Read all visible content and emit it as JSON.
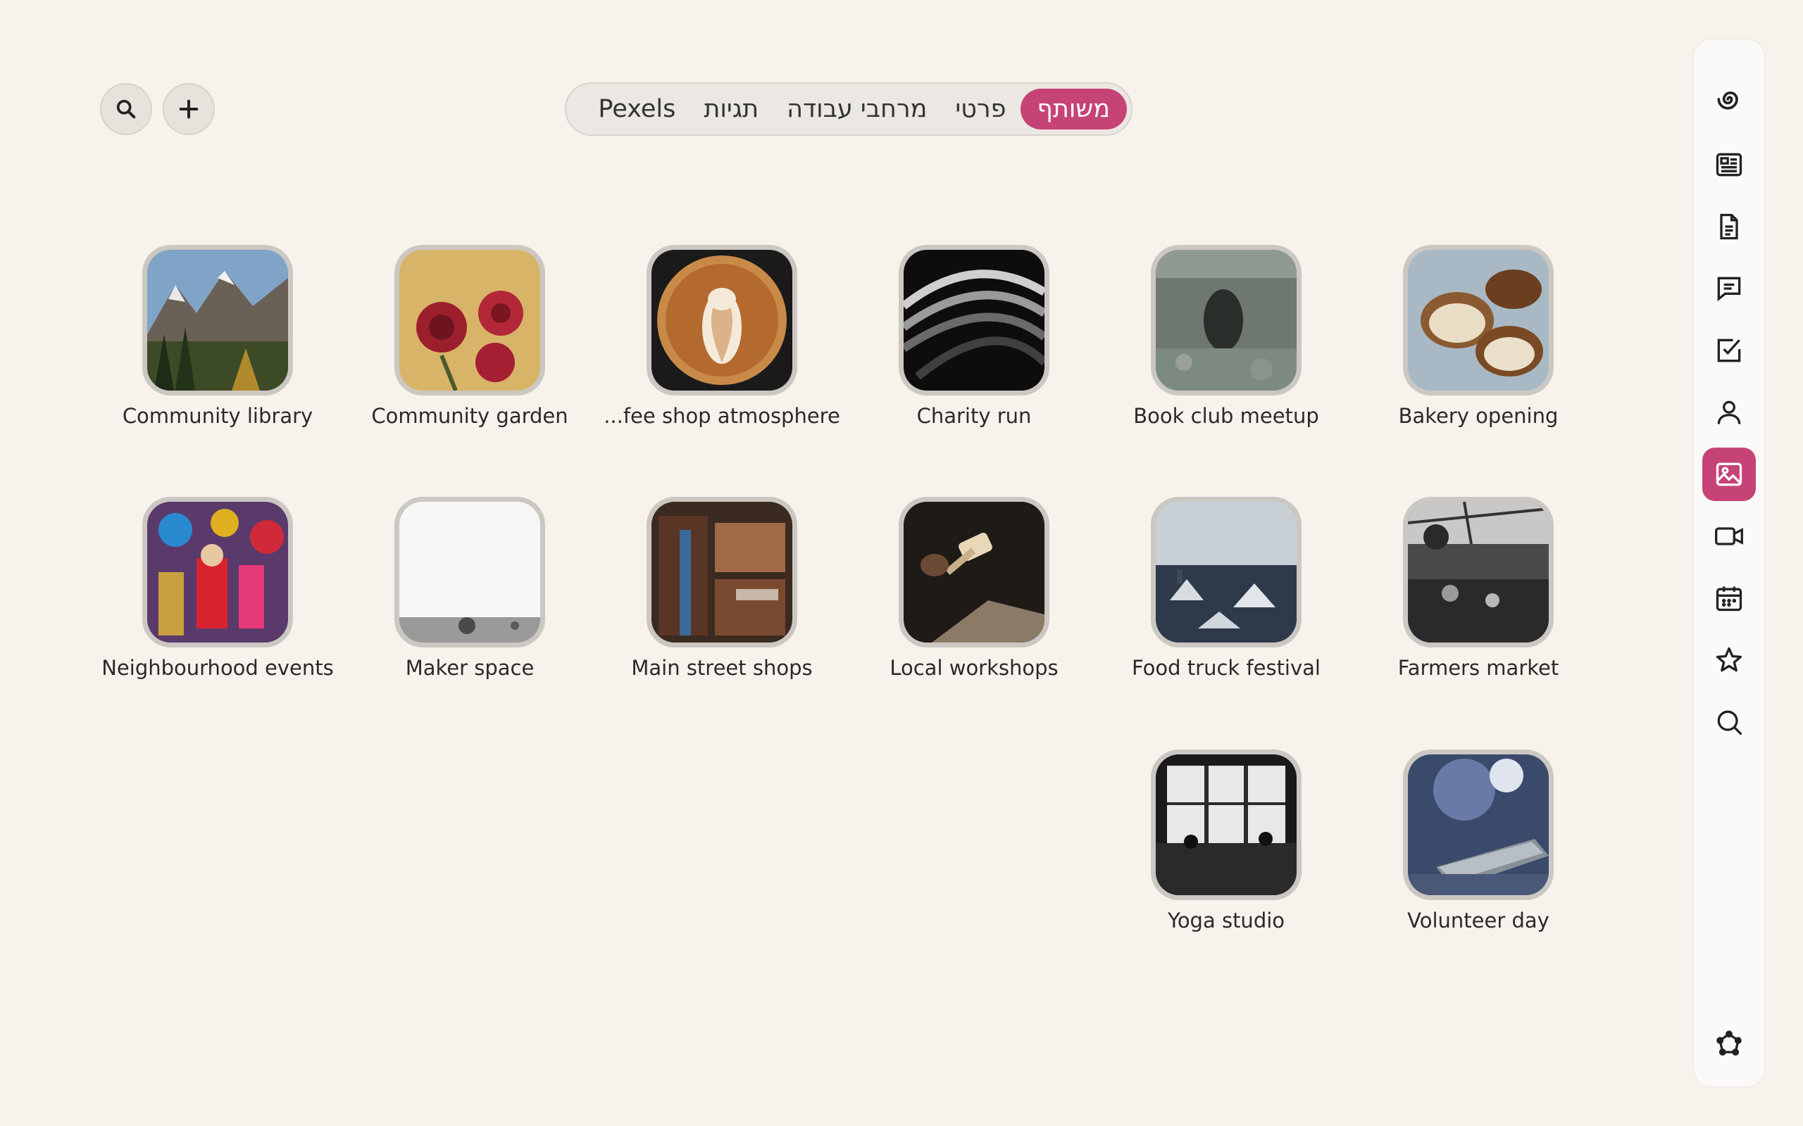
{
  "toolbar": {
    "search_icon": "search-icon",
    "add_icon": "plus-icon"
  },
  "tabs": [
    {
      "label": "משותף",
      "active": true
    },
    {
      "label": "פרטי",
      "active": false
    },
    {
      "label": "מרחבי עבודה",
      "active": false
    },
    {
      "label": "תגיות",
      "active": false
    },
    {
      "label": "Pexels",
      "active": false
    }
  ],
  "albums": [
    {
      "label": "Community library",
      "thumb": "mountains"
    },
    {
      "label": "Community garden",
      "thumb": "roses"
    },
    {
      "label": "...fee shop atmosphere",
      "thumb": "latte"
    },
    {
      "label": "Charity run",
      "thumb": "spiral"
    },
    {
      "label": "Book club meetup",
      "thumb": "rock"
    },
    {
      "label": "Bakery opening",
      "thumb": "bread"
    },
    {
      "label": "Neighbourhood events",
      "thumb": "festival"
    },
    {
      "label": "Maker space",
      "thumb": "field"
    },
    {
      "label": "Main street shops",
      "thumb": "street"
    },
    {
      "label": "Local workshops",
      "thumb": "mallet"
    },
    {
      "label": "Food truck festival",
      "thumb": "city"
    },
    {
      "label": "Farmers market",
      "thumb": "market"
    },
    {
      "label": "Yoga studio",
      "thumb": "window"
    },
    {
      "label": "Volunteer day",
      "thumb": "phone"
    }
  ],
  "sidebar": {
    "items": [
      "logo-swirl-icon",
      "news-icon",
      "document-icon",
      "chat-icon",
      "checkbox-icon",
      "person-icon",
      "image-icon",
      "video-icon",
      "calendar-icon",
      "star-icon",
      "search-icon"
    ],
    "active": "image-icon",
    "bottom": "settings-icon"
  },
  "colors": {
    "accent": "#c64375",
    "background": "#f7f2ec"
  }
}
